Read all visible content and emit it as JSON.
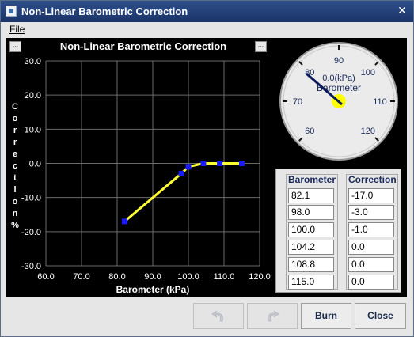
{
  "window": {
    "title": "Non-Linear Barometric Correction",
    "close_glyph": "✕"
  },
  "menu": {
    "file_label": "File"
  },
  "chart_mini_buttons": {
    "left": "...",
    "right": "..."
  },
  "chart_data": {
    "type": "line",
    "title": "Non-Linear Barometric Correction",
    "xlabel": "Barometer (kPa)",
    "ylabel": "Correction %",
    "xlim": [
      60.0,
      120.0
    ],
    "ylim": [
      -30.0,
      30.0
    ],
    "xticks": [
      "60.0",
      "70.0",
      "80.0",
      "90.0",
      "100.0",
      "110.0",
      "120.0"
    ],
    "yticks": [
      "30.0",
      "20.0",
      "10.0",
      "0.0",
      "-10.0",
      "-20.0",
      "-30.0"
    ],
    "x": [
      82.1,
      98.0,
      100.0,
      104.2,
      108.8,
      115.0
    ],
    "y": [
      -17.0,
      -3.0,
      -1.0,
      0.0,
      0.0,
      0.0
    ],
    "grid": true,
    "line_color": "#ffff33",
    "point_color": "#1a1aff"
  },
  "gauge": {
    "label": "Barometer",
    "value_text": "0.0(kPa)",
    "value": 0.0,
    "ticks": [
      "60",
      "70",
      "80",
      "90",
      "100",
      "110",
      "120"
    ],
    "min": 60,
    "max": 120
  },
  "table": {
    "barometer_header": "Barometer",
    "correction_header": "Correction",
    "barometer_values": [
      "82.1",
      "98.0",
      "100.0",
      "104.2",
      "108.8",
      "115.0"
    ],
    "correction_values": [
      "-17.0",
      "-3.0",
      "-1.0",
      "0.0",
      "0.0",
      "0.0"
    ]
  },
  "buttons": {
    "undo_icon": "undo-icon",
    "redo_icon": "redo-icon",
    "burn_label": "Burn",
    "close_label": "Close"
  },
  "colors": {
    "title_bar": "#1f3c74",
    "plot_bg": "#000000",
    "line": "#ffff33",
    "points": "#1a1aff"
  }
}
